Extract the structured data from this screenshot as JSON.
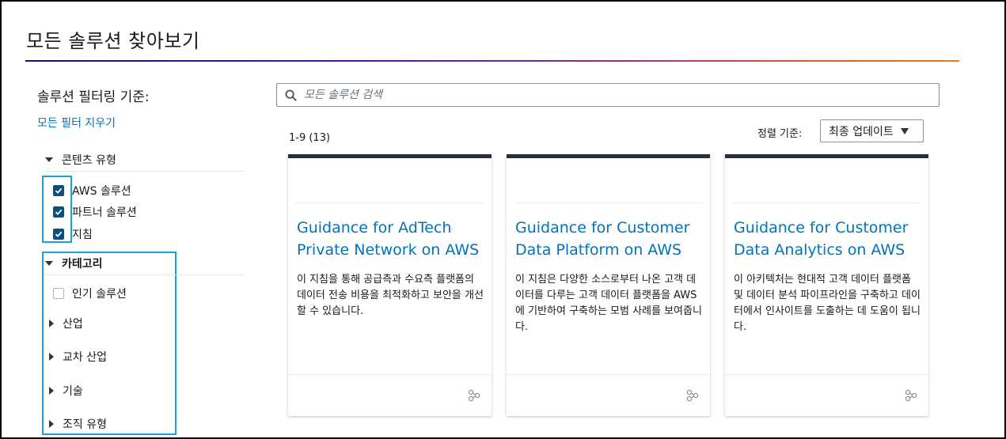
{
  "page": {
    "title": "모든 솔루션 찾아보기"
  },
  "sidebar": {
    "heading": "솔루션 필터링 기준:",
    "clear_all": "모든 필터 지우기",
    "content_type": {
      "label": "콘텐츠 유형",
      "options": [
        {
          "label": "AWS 솔루션",
          "checked": true
        },
        {
          "label": "파트너 솔루션",
          "checked": true
        },
        {
          "label": "지침",
          "checked": true
        }
      ]
    },
    "category": {
      "label": "카테고리",
      "popular": {
        "label": "인기 솔루션",
        "checked": false
      },
      "subsections": [
        {
          "label": "산업"
        },
        {
          "label": "교차 산업"
        },
        {
          "label": "기술"
        },
        {
          "label": "조직 유형"
        }
      ]
    }
  },
  "search": {
    "placeholder": "모든 솔루션 검색"
  },
  "results": {
    "count_text": "1-9 (13)"
  },
  "sort": {
    "label": "정렬 기준:",
    "selected": "최종 업데이트"
  },
  "cards": [
    {
      "title": "Guidance for AdTech Private Network on AWS",
      "description": "이 지침을 통해 공급측과 수요측 플랫폼의 데이터 전송 비용을 최적화하고 보안을 개선할 수 있습니다."
    },
    {
      "title": "Guidance for Customer Data Platform on AWS",
      "description": "이 지침은 다양한 소스로부터 나온 고객 데이터를 다루는 고객 데이터 플랫폼을 AWS에 기반하여 구축하는 모범 사례를 보여줍니다."
    },
    {
      "title": "Guidance for Customer Data Analytics on AWS",
      "description": "이 아키텍처는 현대적 고객 데이터 플랫폼 및 데이터 분석 파이프라인을 구축하고 데이터에서 인사이트를 도출하는 데 도움이 됩니다."
    }
  ],
  "colors": {
    "link": "#0073bb",
    "checkbox": "#0d4f7c",
    "card_top": "#232f3e",
    "highlight": "#1aa2d8"
  }
}
